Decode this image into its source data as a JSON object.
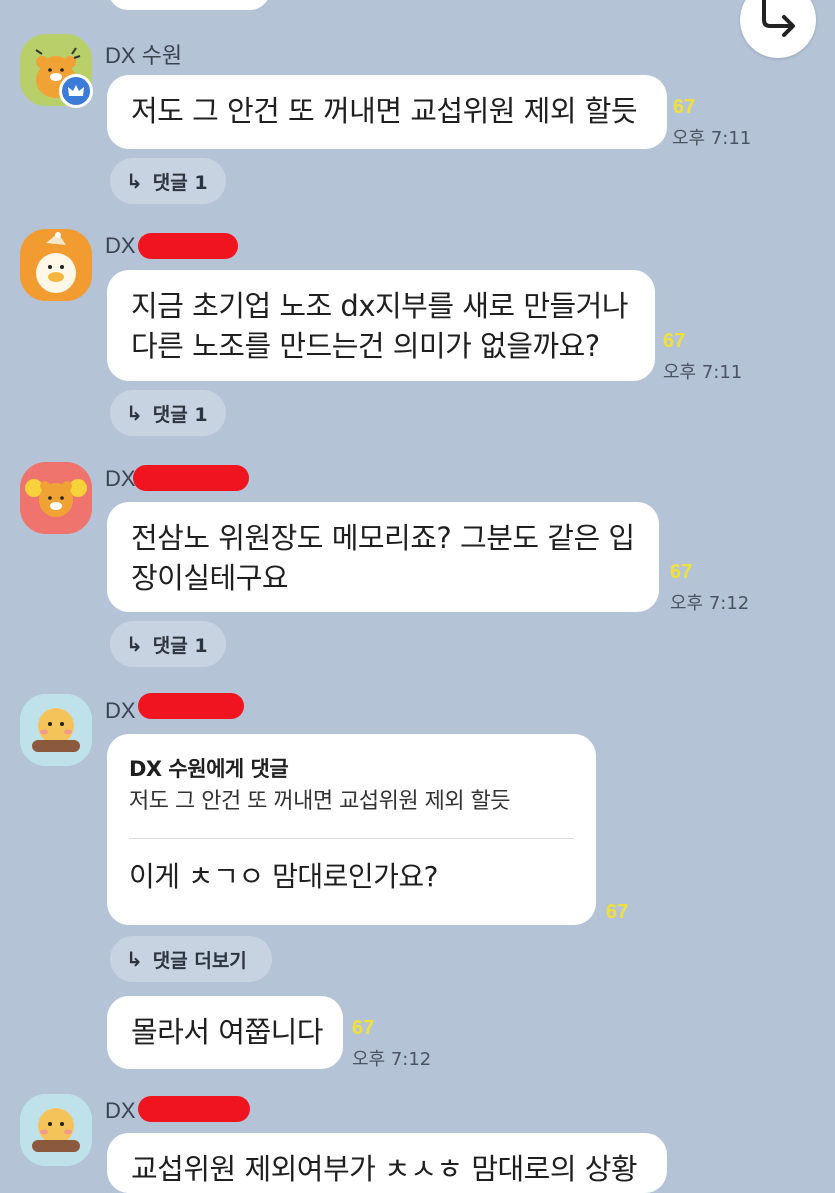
{
  "share_button": {
    "icon": "share-arrow-icon"
  },
  "messages": [
    {
      "sender": "DX 수원",
      "text": [
        "저도 그 안건 또 꺼내면 교섭위원 제외 할듯"
      ],
      "unread": "67",
      "time": "오후 7:11",
      "reply_label": "댓글 1"
    },
    {
      "sender": "DX",
      "text": [
        "지금 초기업 노조 dx지부를 새로 만들거나",
        "다른 노조를 만드는건 의미가 없을까요?"
      ],
      "unread": "67",
      "time": "오후 7:11",
      "reply_label": "댓글 1"
    },
    {
      "sender": "DX",
      "text": [
        "전삼노 위원장도 메모리죠? 그분도 같은 입",
        "장이실테구요"
      ],
      "unread": "67",
      "time": "오후 7:12",
      "reply_label": "댓글 1"
    },
    {
      "sender": "DX",
      "quote_title": "DX 수원에게 댓글",
      "quote_text": "저도 그 안건 또 꺼내면 교섭위원 제외 할듯",
      "text": [
        "이게 ㅊㄱㅇ 맘대로인가요?"
      ],
      "unread": "67",
      "reply_label": "댓글 더보기"
    },
    {
      "text": [
        "몰라서 여쭙니다"
      ],
      "unread": "67",
      "time": "오후 7:12"
    },
    {
      "sender": "DX",
      "text": [
        "교섭위원 제외여부가 ㅊㅅㅎ 맘대로의 상황"
      ]
    }
  ],
  "colors": {
    "background": "#b4c4d6",
    "bubble": "#ffffff",
    "unread": "#f2e03a",
    "redaction": "#f0141e"
  }
}
